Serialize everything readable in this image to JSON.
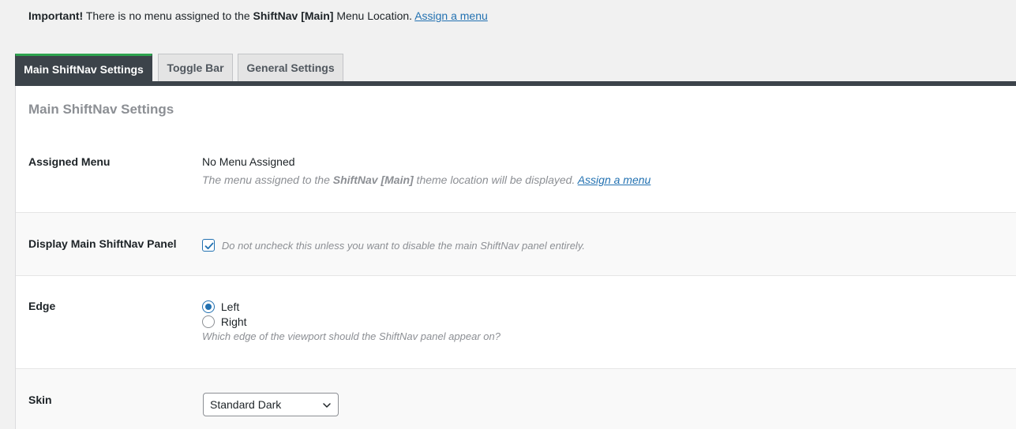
{
  "notice": {
    "important": "Important!",
    "text_before": " There is no menu assigned to the ",
    "location_name": "ShiftNav [Main]",
    "text_after": " Menu Location. ",
    "link": "Assign a menu"
  },
  "tabs": [
    {
      "label": "Main ShiftNav Settings",
      "active": true
    },
    {
      "label": "Toggle Bar",
      "active": false
    },
    {
      "label": "General Settings",
      "active": false
    }
  ],
  "panel": {
    "title": "Main ShiftNav Settings"
  },
  "assigned_menu": {
    "label": "Assigned Menu",
    "value": "No Menu Assigned",
    "desc_before": "The menu assigned to the ",
    "desc_bold": "ShiftNav [Main]",
    "desc_after": " theme location will be displayed. ",
    "link": "Assign a menu",
    "arrow_color": "#e8111a"
  },
  "display_panel": {
    "label": "Display Main ShiftNav Panel",
    "checked": true,
    "desc": "Do not uncheck this unless you want to disable the main ShiftNav panel entirely."
  },
  "edge": {
    "label": "Edge",
    "options": [
      {
        "label": "Left",
        "checked": true
      },
      {
        "label": "Right",
        "checked": false
      }
    ],
    "desc": "Which edge of the viewport should the ShiftNav panel appear on?"
  },
  "skin": {
    "label": "Skin",
    "selected": "Standard Dark"
  },
  "colors": {
    "accent": "#2271b1",
    "tab_active_bg": "#3c434a",
    "tab_active_top": "#2ea44f"
  }
}
